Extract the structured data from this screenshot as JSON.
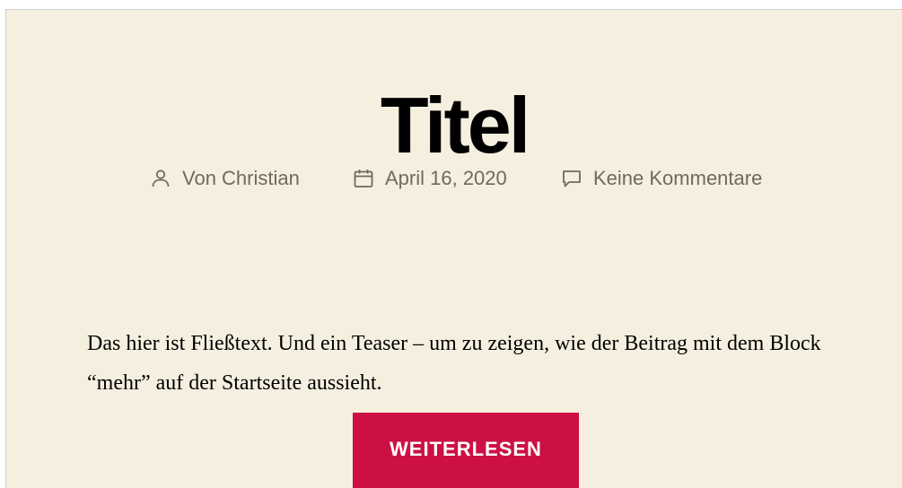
{
  "post": {
    "title": "Titel",
    "meta": {
      "author": "Von Christian",
      "date": "April 16, 2020",
      "comments": "Keine Kommentare"
    },
    "teaser": "Das hier ist Fließtext. Und ein Teaser – um zu zeigen, wie der Beitrag mit dem Block “mehr” auf der Startseite aussieht.",
    "read_more": "WEITERLESEN"
  },
  "icons": {
    "author": "person-icon",
    "date": "calendar-icon",
    "comments": "speech-bubble-icon"
  },
  "colors": {
    "background": "#f5efe0",
    "title": "#000000",
    "meta_text": "#6d6a5e",
    "button": "#cd1044",
    "button_text": "#ffffff"
  }
}
